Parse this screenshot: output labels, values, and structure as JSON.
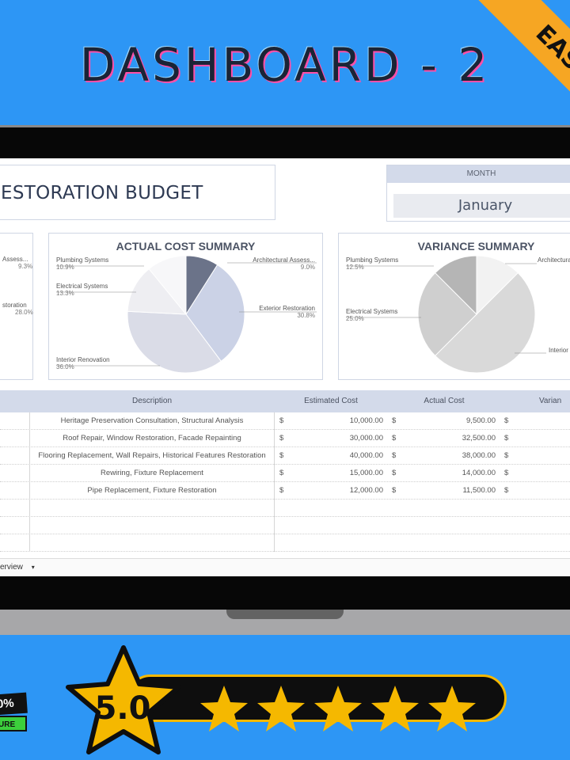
{
  "promo": {
    "title": "DASHBOARD - 2",
    "corner_badge": "EAS",
    "rating": "5.0",
    "badge_top": "0%",
    "badge_bottom": "URE"
  },
  "dashboard": {
    "title": "ESTORATION BUDGET",
    "month_label": "MONTH",
    "month_value": "January"
  },
  "left_panel": {
    "labels": [
      {
        "name": "Assess...",
        "pct": "9.3%"
      },
      {
        "name": "storation",
        "pct": "28.0%"
      }
    ]
  },
  "actual_cost_summary": {
    "title": "ACTUAL COST SUMMARY"
  },
  "variance_summary": {
    "title": "VARIANCE SUMMARY"
  },
  "chart_data": [
    {
      "type": "pie",
      "title": "ACTUAL COST SUMMARY",
      "series": [
        {
          "name": "Architectural Assess...",
          "value": 9.0,
          "label": "9.0%",
          "color": "#6b7389"
        },
        {
          "name": "Exterior Restoration",
          "value": 30.8,
          "label": "30.8%",
          "color": "#cbd2e6"
        },
        {
          "name": "Interior Renovation",
          "value": 36.0,
          "label": "36.0%",
          "color": "#dadce7"
        },
        {
          "name": "Electrical Systems",
          "value": 13.3,
          "label": "13.3%",
          "color": "#eeeeF2"
        },
        {
          "name": "Plumbing Systems",
          "value": 10.9,
          "label": "10.9%",
          "color": "#f7f7f9"
        }
      ]
    },
    {
      "type": "pie",
      "title": "VARIANCE SUMMARY",
      "series": [
        {
          "name": "Architectural",
          "value": 12.5,
          "label": "",
          "color": "#f2f2f2"
        },
        {
          "name": "Interior",
          "value": 50.0,
          "label": "",
          "color": "#d9d9d9"
        },
        {
          "name": "Electrical Systems",
          "value": 25.0,
          "label": "25.0%",
          "color": "#cfcfcf"
        },
        {
          "name": "Plumbing Systems",
          "value": 12.5,
          "label": "12.5%",
          "color": "#b5b5b5"
        }
      ]
    }
  ],
  "table": {
    "headers": {
      "description": "Description",
      "estimated": "Estimated Cost",
      "actual": "Actual Cost",
      "variance": "Varian"
    },
    "rows": [
      {
        "description": "Heritage Preservation Consultation, Structural Analysis",
        "cur1": "$",
        "estimated": "10,000.00",
        "cur2": "$",
        "actual": "9,500.00",
        "cur3": "$"
      },
      {
        "description": "Roof Repair, Window Restoration, Facade Repainting",
        "cur1": "$",
        "estimated": "30,000.00",
        "cur2": "$",
        "actual": "32,500.00",
        "cur3": "$"
      },
      {
        "description": "Flooring Replacement, Wall Repairs, Historical Features Restoration",
        "cur1": "$",
        "estimated": "40,000.00",
        "cur2": "$",
        "actual": "38,000.00",
        "cur3": "$"
      },
      {
        "description": "Rewiring, Fixture Replacement",
        "cur1": "$",
        "estimated": "15,000.00",
        "cur2": "$",
        "actual": "14,000.00",
        "cur3": "$"
      },
      {
        "description": "Pipe Replacement, Fixture Restoration",
        "cur1": "$",
        "estimated": "12,000.00",
        "cur2": "$",
        "actual": "11,500.00",
        "cur3": "$"
      }
    ]
  },
  "sheet": {
    "tab_label": "erview",
    "tab_arrow": "▾"
  }
}
